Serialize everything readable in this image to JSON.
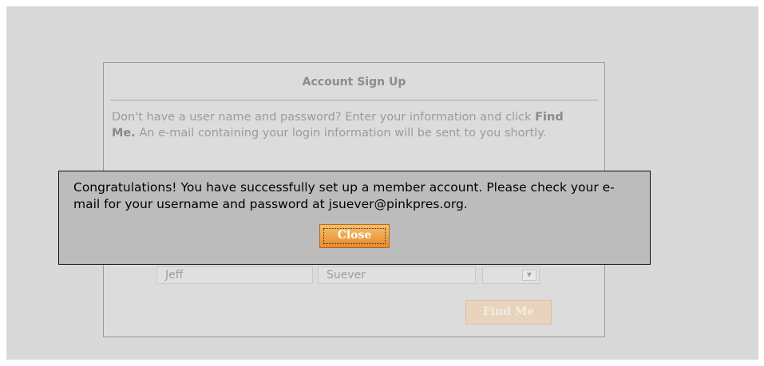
{
  "signup": {
    "title": "Account Sign Up",
    "intro_before": "Don't have a user name and password? Enter your information and click ",
    "intro_bold": "Find Me.",
    "intro_after": " An e-mail containing your login information will be sent to you shortly.",
    "first_name_value": "Jeff",
    "last_name_value": "Suever",
    "select_value": "",
    "find_button": "Find Me"
  },
  "alert": {
    "message": "Congratulations! You have successfully set up a member account. Please check your e-mail for your username and password at jsuever@pinkpres.org.",
    "close_button": "Close"
  },
  "icons": {
    "select_arrow": "chevron-down-icon"
  },
  "colors": {
    "close_button": "#e88a2c",
    "find_button_disabled": "#e8d3bd",
    "dialog_background": "#bcbcbc"
  }
}
